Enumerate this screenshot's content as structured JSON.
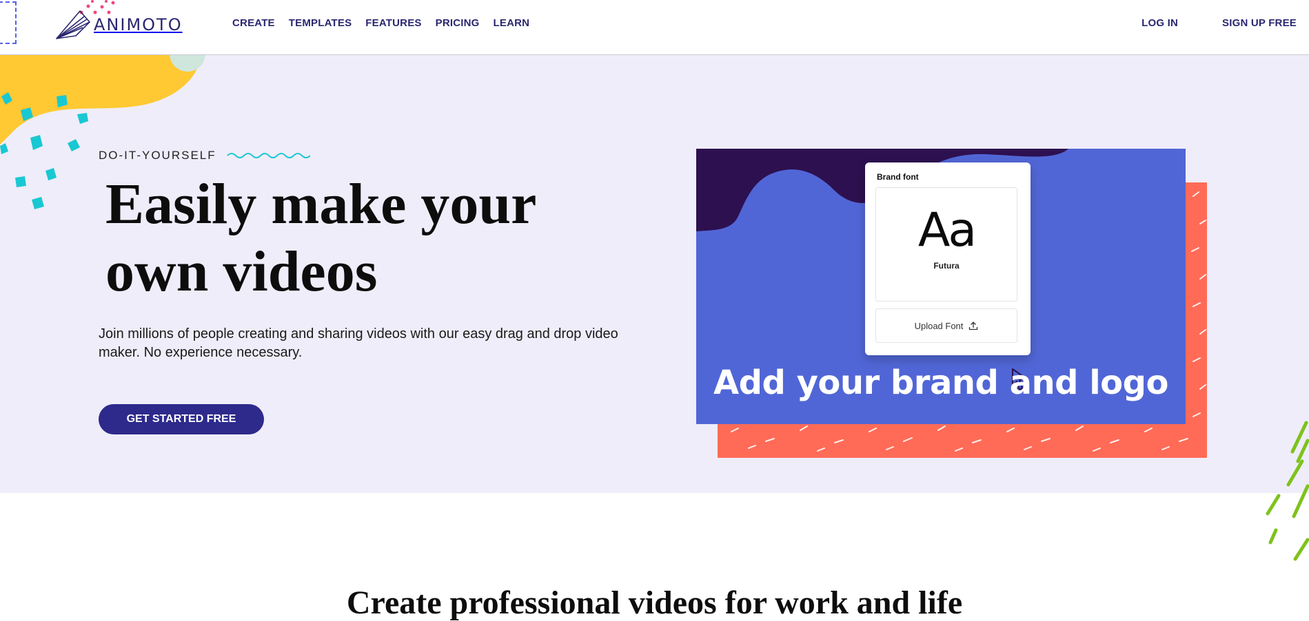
{
  "header": {
    "brand": "ANIMOTO",
    "nav": [
      "CREATE",
      "TEMPLATES",
      "FEATURES",
      "PRICING",
      "LEARN"
    ],
    "login_label": "LOG IN",
    "signup_label": "SIGN UP FREE"
  },
  "hero": {
    "eyebrow": "DO-IT-YOURSELF",
    "headline": "Easily make your own videos",
    "subtext": "Join millions of people creating and sharing videos with our easy drag and drop video maker. No experience necessary.",
    "cta_label": "GET STARTED FREE"
  },
  "preview_card": {
    "panel_title": "Brand font",
    "sample_glyphs": "Aa",
    "font_name": "Futura",
    "upload_label": "Upload Font",
    "caption": "Add your brand and logo"
  },
  "section": {
    "title": "Create professional videos for work and life"
  },
  "colors": {
    "brand_navy": "#2d2a8c",
    "hero_bg": "#efedf9",
    "card_blue": "#5166d6",
    "card_dark": "#2d1050",
    "coral": "#ff6b57",
    "teal": "#19c8d2",
    "yellow": "#ffc933",
    "green": "#7fc21c"
  }
}
